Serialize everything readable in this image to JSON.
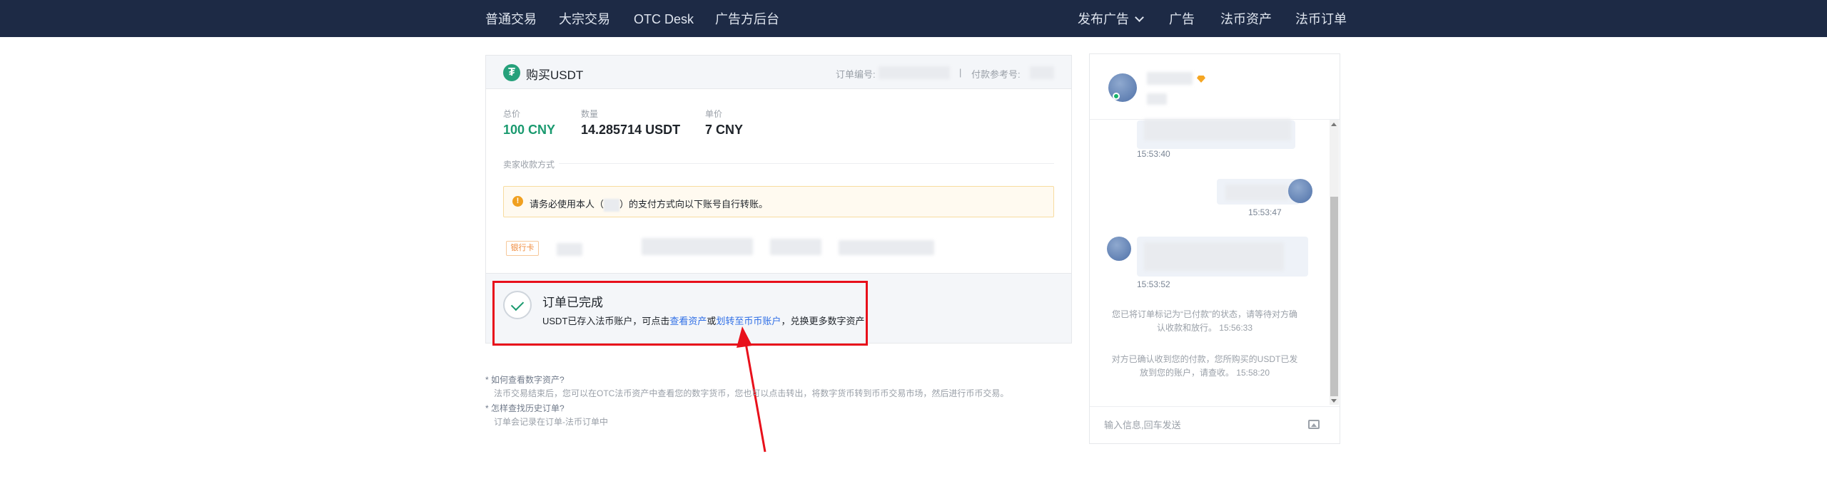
{
  "nav": {
    "left": [
      "普通交易",
      "大宗交易",
      "OTC Desk",
      "广告方后台"
    ],
    "publish_ad": "发布广告",
    "right": [
      "广告",
      "法币资产",
      "法币订单"
    ]
  },
  "order": {
    "icon_glyph": "₮",
    "title": "购买USDT",
    "order_no_label": "订单编号:",
    "separator": "|",
    "pay_ref_label": "付款参考号:",
    "total_label": "总价",
    "total_value": "100 CNY",
    "qty_label": "数量",
    "qty_value": "14.285714 USDT",
    "price_label": "单价",
    "price_value": "7 CNY",
    "payment_section_label": "卖家收款方式",
    "warning_icon": "!",
    "warning_prefix": "请务必使用本人（",
    "warning_suffix": "）的支付方式向以下账号自行转账。",
    "bank_badge": "银行卡",
    "done_title": "订单已完成",
    "done_desc_1": "USDT已存入法币账户，可点击",
    "done_link_1": "查看资产",
    "done_desc_2": "或",
    "done_link_2": "划转至币币账户",
    "done_desc_3": "，兑换更多数字资产"
  },
  "help": {
    "q1": "* 如何查看数字资产?",
    "a1": "法币交易结束后，您可以在OTC法币资产中查看您的数字货币，您也可以点击转出，将数字货币转到币币交易市场，然后进行币币交易。",
    "q2": "* 怎样查找历史订单?",
    "a2": "订单会记录在订单-法币订单中"
  },
  "chat": {
    "times": [
      "15:53:40",
      "15:53:47",
      "15:53:52"
    ],
    "sys_msg_1": "您已将订单标记为“已付款”的状态，请等待对方确认收款和放行。 15:56:33",
    "sys_msg_2": "对方已确认收到您的付款，您所购买的USDT已发放到您的账户，请查收。 15:58:20",
    "input_placeholder": "输入信息,回车发送"
  },
  "colors": {
    "nav_bg": "#1d2a45",
    "accent_green": "#1a9a6f",
    "link_blue": "#2f6fe6",
    "annotation_red": "#e8101b",
    "tether_green": "#26a17b"
  }
}
